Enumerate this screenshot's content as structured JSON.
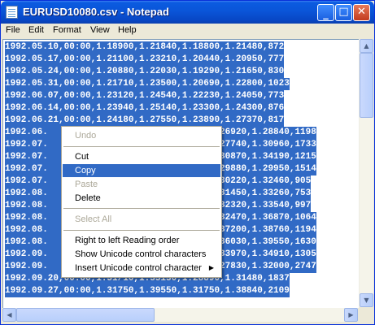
{
  "window": {
    "title": "EURUSD10080.csv - Notepad",
    "controls": {
      "minimize": "_",
      "maximize": "□",
      "close": "✕"
    }
  },
  "menubar": {
    "items": [
      {
        "label": "File"
      },
      {
        "label": "Edit"
      },
      {
        "label": "Format"
      },
      {
        "label": "View"
      },
      {
        "label": "Help"
      }
    ]
  },
  "editor": {
    "lines": [
      "1992.05.10,00:00,1.18900,1.21840,1.18800,1.21480,872",
      "1992.05.17,00:00,1.21100,1.23210,1.20440,1.20950,777",
      "1992.05.24,00:00,1.20880,1.22030,1.19290,1.21650,830",
      "1992.05.31,00:00,1.21710,1.23500,1.20690,1.22800,1023",
      "1992.06.07,00:00,1.23120,1.24540,1.22230,1.24050,773",
      "1992.06.14,00:00,1.23940,1.25140,1.23300,1.24300,876",
      "1992.06.21,00:00,1.24180,1.27550,1.23890,1.27370,817",
      "1992.06.                              1.26920,1.28840,1198",
      "1992.07.                              1.27740,1.30960,1733",
      "1992.07.                              1.30870,1.34190,1215",
      "1992.07.                              1.29880,1.29950,1514",
      "1992.07.                              1.30220,1.32460,905",
      "1992.08.                              1.31450,1.33260,753",
      "1992.08.                              1.32320,1.33540,997",
      "1992.08.                              1.32470,1.36870,1064",
      "1992.08.                              1.37200,1.38760,1194",
      "1992.08.                              1.36030,1.39550,1630",
      "1992.09.                              1.33970,1.34910,1305",
      "1992.09.                              1.27830,1.32000,2747",
      "1992.09.20,00:00,1.31/10,1.33130,1.28890,1.31480,1837",
      "1992.09.27,00:00,1.31750,1.39550,1.31750,1.38840,2109"
    ]
  },
  "context_menu": {
    "items": [
      {
        "label": "Undo",
        "enabled": false
      },
      {
        "label": "Cut",
        "enabled": true
      },
      {
        "label": "Copy",
        "enabled": true,
        "highlighted": true
      },
      {
        "label": "Paste",
        "enabled": false
      },
      {
        "label": "Delete",
        "enabled": true
      },
      {
        "label": "Select All",
        "enabled": false
      },
      {
        "label": "Right to left Reading order",
        "enabled": true
      },
      {
        "label": "Show Unicode control characters",
        "enabled": true
      },
      {
        "label": "Insert Unicode control character",
        "enabled": true,
        "submenu_arrow": "▶"
      }
    ]
  },
  "scrollbars": {
    "up_arrow": "▲",
    "down_arrow": "▼",
    "left_arrow": "◀",
    "right_arrow": "▶"
  },
  "colors": {
    "selection": "#316ac5",
    "titlebar": "#0a55d8",
    "menu_highlight": "#316ac5"
  }
}
